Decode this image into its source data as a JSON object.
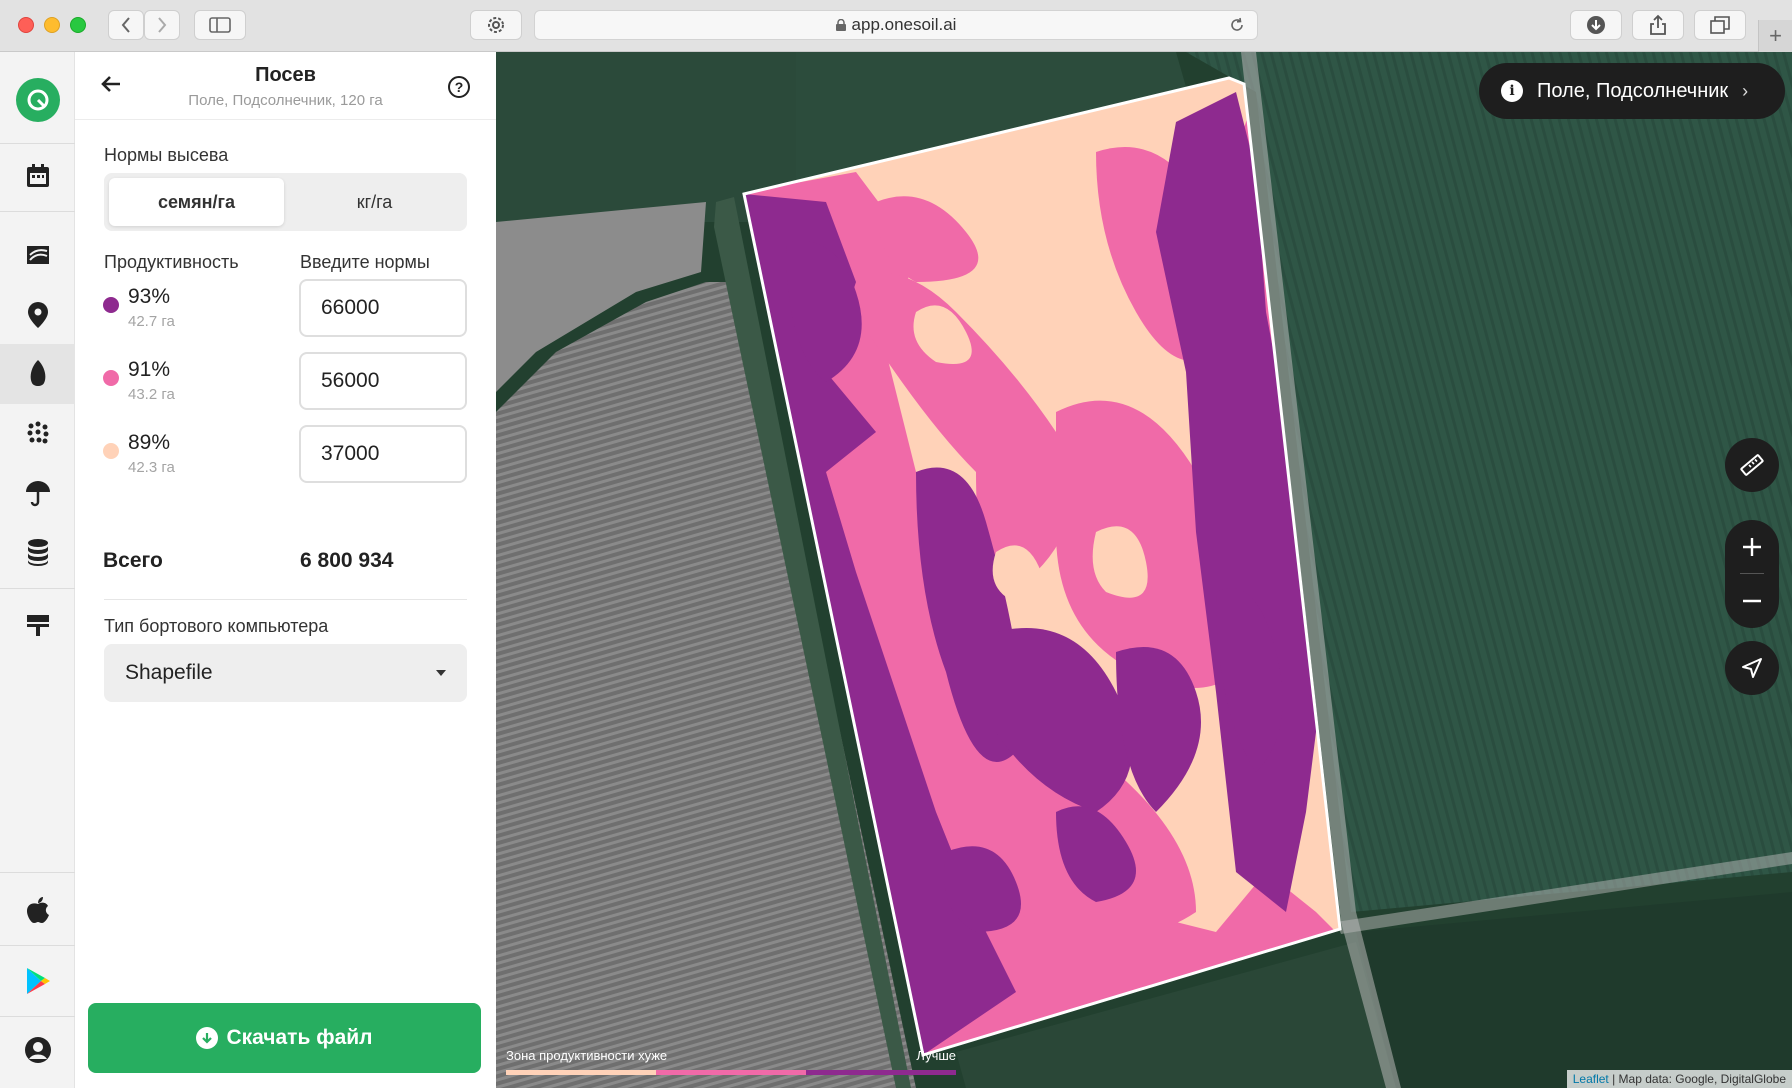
{
  "browser": {
    "url": "app.onesoil.ai"
  },
  "panel": {
    "title": "Посев",
    "subtitle": "Поле, Подсолнечник, 120 га",
    "help_label": "?",
    "seeding_rates_label": "Нормы высева",
    "units": {
      "selected": "семян/га",
      "other": "кг/га"
    },
    "productivity_header": "Продуктивность",
    "rates_header": "Введите нормы",
    "zones": [
      {
        "percent": "93%",
        "area": "42.7 га",
        "rate": "66000",
        "color": "#8e2a8f"
      },
      {
        "percent": "91%",
        "area": "43.2 га",
        "rate": "56000",
        "color": "#f06aa8"
      },
      {
        "percent": "89%",
        "area": "42.3 га",
        "rate": "37000",
        "color": "#ffd2b8"
      }
    ],
    "total_label": "Всего",
    "total_value": "6 800 934",
    "computer_type_label": "Тип бортового компьютера",
    "computer_type_value": "Shapefile",
    "download_label": "Скачать файл"
  },
  "map": {
    "field_pill": "Поле, Подсолнечник",
    "legend_worse": "Зона продуктивности хуже",
    "legend_better": "Лучше",
    "legend_colors": [
      "#ffd2b8",
      "#f06aa8",
      "#8e2a8f"
    ],
    "attribution_link": "Leaflet",
    "attribution_text": "| Map data: Google, DigitalGlobe"
  },
  "rail_icons": [
    "onesoil-logo-icon",
    "calendar-icon",
    "fields-icon",
    "location-pin-icon",
    "seed-icon",
    "seeds-grid-icon",
    "umbrella-icon",
    "database-icon",
    "machinery-icon",
    "apple-store-icon",
    "google-play-icon",
    "user-icon"
  ],
  "colors": {
    "brand_green": "#27ae60",
    "zone_high": "#8e2a8f",
    "zone_mid": "#f06aa8",
    "zone_low": "#ffd2b8"
  }
}
